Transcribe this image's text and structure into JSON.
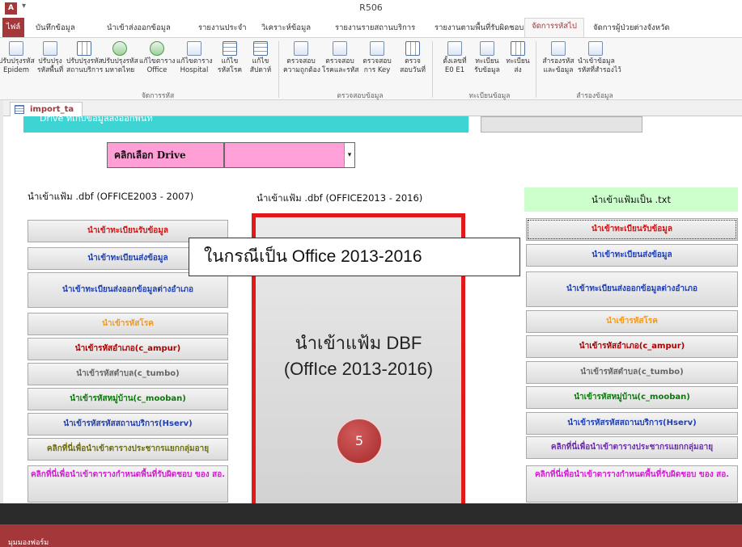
{
  "window": {
    "app_icon": "A",
    "title": "R506"
  },
  "ribbon_tabs": [
    "ไฟล์",
    "บันทึกข้อมูล",
    "นำเข้าส่งออกข้อมูล",
    "รายงานประจำ",
    "วิเคราะห์ข้อมูล",
    "รายงานรายสถานบริการ",
    "รายงานตามพื้นที่รับผิดชอบ",
    "จัดการรหัสไป",
    "จัดการผู้ป่วยต่างจังหวัด"
  ],
  "ribbon": {
    "buttons": [
      {
        "line1": "ปรับปรุงรหัส",
        "line2": "Epidem",
        "icon": "document-icon"
      },
      {
        "line1": "ปรับปรุง",
        "line2": "รหัสพื้นที่",
        "icon": "query-icon"
      },
      {
        "line1": "ปรับปรุงรหัส",
        "line2": "สถานบริการ",
        "icon": "calendar-grid-icon"
      },
      {
        "line1": "ปรับปรุงรหัส",
        "line2": "มหาดไทย",
        "icon": "people-icon"
      },
      {
        "line1": "แก้ไขตาราง",
        "line2": "Office",
        "icon": "people-icon"
      },
      {
        "line1": "แก้ไขตาราง",
        "line2": "Hospital",
        "icon": "document-icon"
      },
      {
        "line1": "แก้ไข",
        "line2": "รหัสโรค",
        "icon": "table-icon"
      },
      {
        "line1": "แก้ไข",
        "line2": "สัปดาห์",
        "icon": "table-icon"
      },
      {
        "line1": "ตรวจสอบ",
        "line2": "ความถูกต้อง",
        "icon": "document-icon"
      },
      {
        "line1": "ตรวจสอบ",
        "line2": "โรคและรหัส",
        "icon": "query-icon"
      },
      {
        "line1": "ตรวจสอบ",
        "line2": "การ Key",
        "icon": "query-icon"
      },
      {
        "line1": "ตรวจ",
        "line2": "สอบวันที่",
        "icon": "calendar-grid-icon"
      },
      {
        "line1": "ตั้งเลขที่",
        "line2": "E0 E1",
        "icon": "document-icon"
      },
      {
        "line1": "ทะเบียน",
        "line2": "รับข้อมูล",
        "icon": "query-icon"
      },
      {
        "line1": "ทะเบียน",
        "line2": "ส่ง",
        "icon": "calendar-grid-icon"
      },
      {
        "line1": "สำรองรหัส",
        "line2": "และข้อมูล",
        "icon": "document-icon"
      },
      {
        "line1": "นำเข้าข้อมูล",
        "line2": "รหัสที่สำรองไว้",
        "icon": "query-icon"
      }
    ],
    "groups": [
      "จัดการรหัส",
      "ตรวจสอบข้อมูล",
      "ทะเบียนข้อมูล",
      "สำรองข้อมูล"
    ]
  },
  "form_tab": "import_ta",
  "banner_text": "Drive ที่เก็บข้อมูลส่งออกพื้นที่",
  "drive_select": {
    "label": "คลิกเลือก Drive",
    "value": "",
    "arrow": "▾"
  },
  "headers": {
    "left": "นำเข้าแฟ้ม .dbf (OFFICE2003 - 2007)",
    "middle": "นำเข้าแฟ้ม .dbf (OFFICE2013 - 2016)",
    "right": "นำเข้าแฟ้มเป็น .txt"
  },
  "left_buttons": [
    "นำเข้าทะเบียนรับข้อมูล",
    "นำเข้าทะเบียนส่งข้อมูล",
    "นำเข้าทะเบียนส่งออกข้อมูลต่างอำเภอ",
    "นำเข้ารหัสโรค",
    "นำเข้ารหัสอำเภอ(c_ampur)",
    "นำเข้ารหัสตำบล(c_tumbo)",
    "นำเข้ารหัสหมู่บ้าน(c_mooban)",
    "นำเข้ารหัสรหัสสถานบริการ(Hserv)",
    "คลิกที่นี่เพื่อนำเข้าตารางประชากรแยกกลุ่มอายุ",
    "คลิกที่นี่เพื่อนำเข้าตารางกำหนดพื้นที่รับผิดชอบ ของ สอ."
  ],
  "right_buttons": [
    "นำเข้าทะเบียนรับข้อมูล",
    "นำเข้าทะเบียนส่งข้อมูล",
    "นำเข้าทะเบียนส่งออกข้อมูลต่างอำเภอ",
    "นำเข้ารหัสโรค",
    "นำเข้ารหัสอำเภอ(c_ampur)",
    "นำเข้ารหัสตำบล(c_tumbo)",
    "นำเข้ารหัสหมู่บ้าน(c_mooban)",
    "นำเข้ารหัสรหัสสถานบริการ(Hserv)",
    "คลิกที่นี่เพื่อนำเข้าตารางประชากรแยกกลุ่มอายุ",
    "คลิกที่นี่เพื่อนำเข้าตารางกำหนดพื้นที่รับผิดชอบ ของ สอ."
  ],
  "dbf_button": {
    "line1": "นำเข้าแฟ้ม DBF",
    "line2": "(OffIce 2013-2016)"
  },
  "step_badge": "5",
  "callout": "ในกรณีเป็น Office 2013-2016",
  "status_text": "มุมมองฟอร์ม",
  "colors": {
    "access_red": "#a4373a",
    "highlight_box": "#e01a1a",
    "banner_cyan": "#3ed4d4",
    "drive_pink": "#ff9fd6",
    "txt_header_green": "#ccffcc"
  }
}
